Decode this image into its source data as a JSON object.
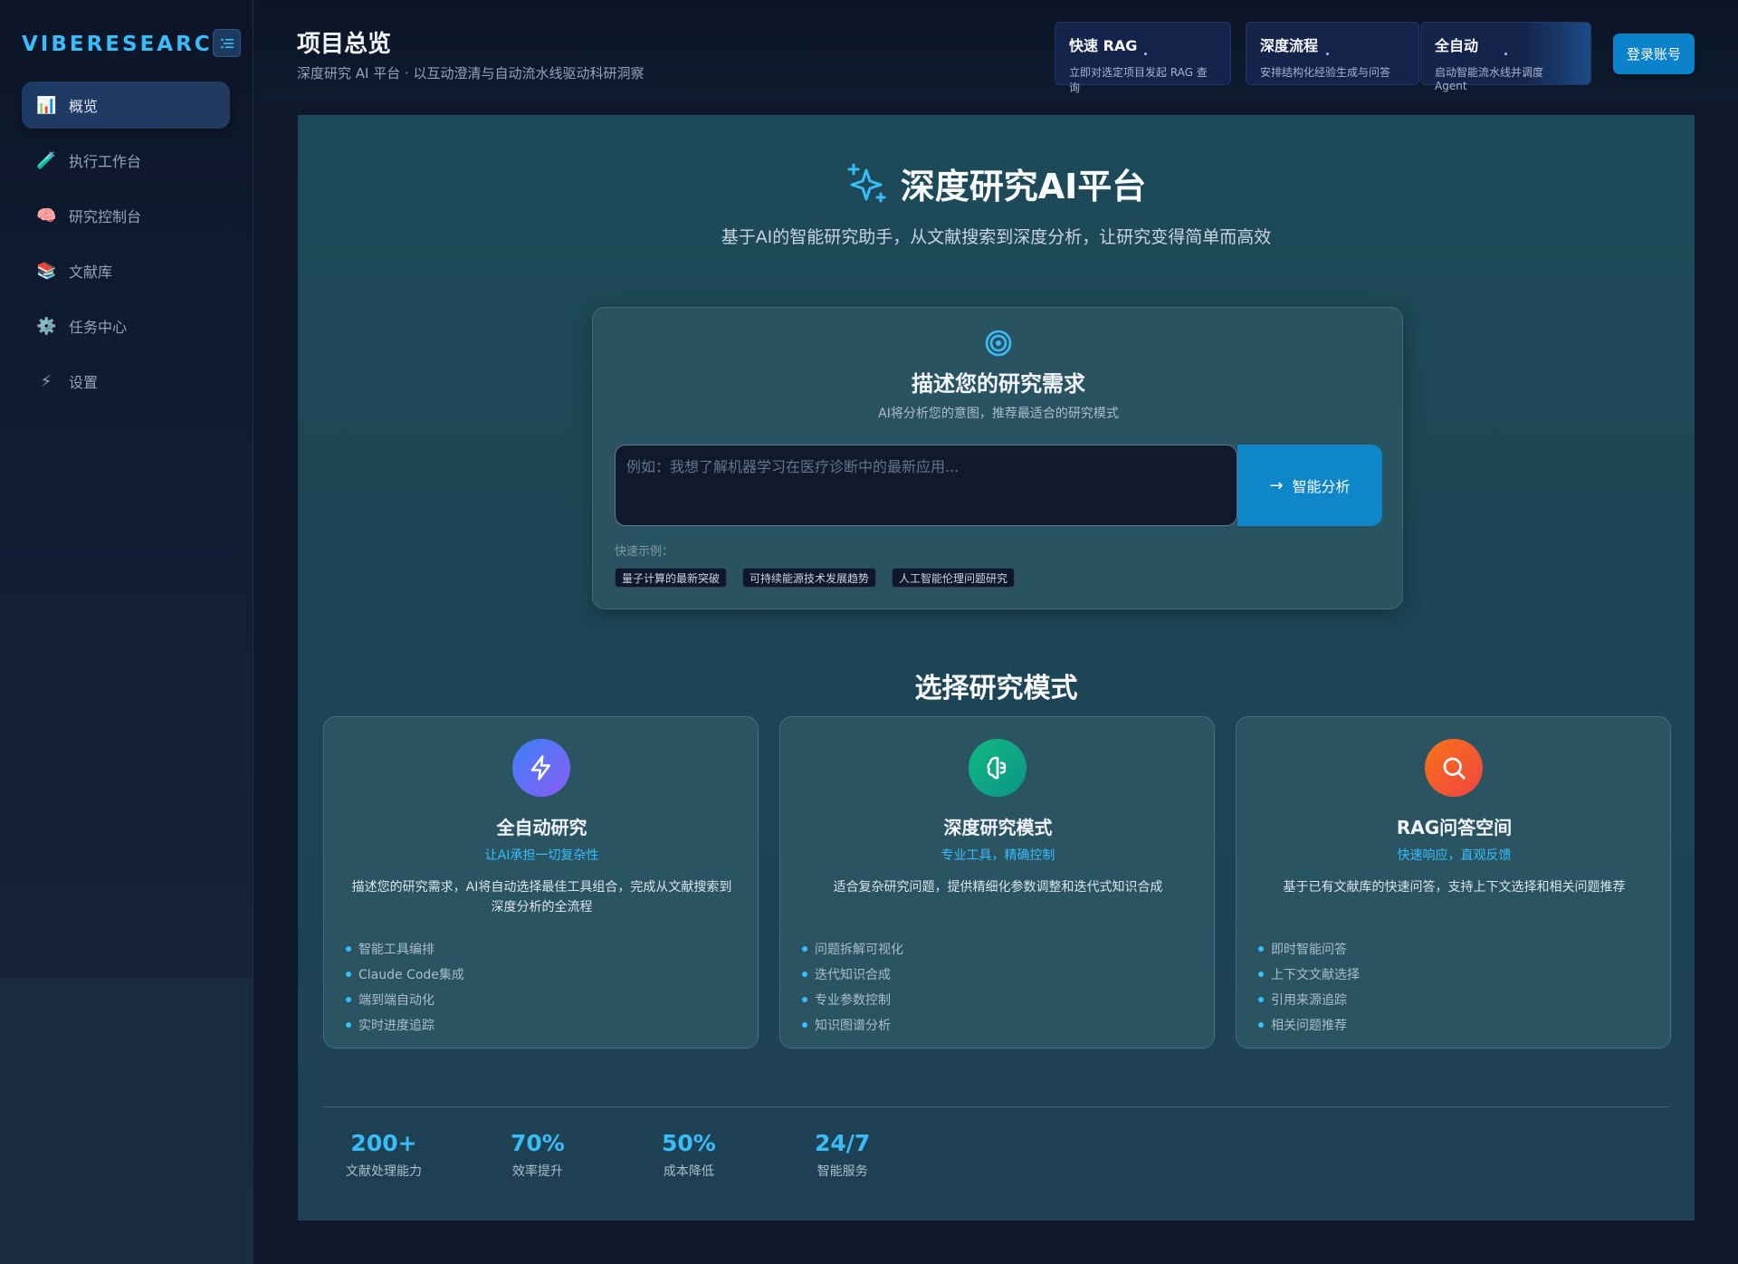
{
  "sidebar": {
    "brand": "VIBERESEARCH",
    "items": [
      {
        "label": "概览",
        "icon": "bar-chart-icon",
        "glyph": "📊",
        "active": true
      },
      {
        "label": "执行工作台",
        "icon": "test-tube-icon",
        "glyph": "🧪",
        "active": false
      },
      {
        "label": "研究控制台",
        "icon": "brain-icon",
        "glyph": "🧠",
        "active": false
      },
      {
        "label": "文献库",
        "icon": "books-icon",
        "glyph": "📚",
        "active": false
      },
      {
        "label": "任务中心",
        "icon": "gear-icon",
        "glyph": "⚙️",
        "active": false
      },
      {
        "label": "设置",
        "icon": "lightning-icon",
        "glyph": "⚡",
        "active": false
      }
    ]
  },
  "header": {
    "title": "项目总览",
    "subtitle": "深度研究 AI 平台 · 以互动澄清与自动流水线驱动科研洞察",
    "modes": [
      {
        "title": "快速 RAG",
        "desc": "立即对选定项目发起 RAG 查询"
      },
      {
        "title": "深度流程",
        "desc": "安排结构化经验生成与问答"
      },
      {
        "title": "全自动",
        "desc": "启动智能流水线并调度 Agent"
      }
    ],
    "login": "登录账号"
  },
  "hero": {
    "title": "深度研究AI平台",
    "subtitle": "基于AI的智能研究助手，从文献搜索到深度分析，让研究变得简单而高效"
  },
  "query": {
    "title": "描述您的研究需求",
    "subtitle": "AI将分析您的意图，推荐最适合的研究模式",
    "placeholder": "例如：我想了解机器学习在医疗诊断中的最新应用...",
    "button": "智能分析",
    "quick_label": "快速示例：",
    "examples": [
      "量子计算的最新突破",
      "可持续能源技术发展趋势",
      "人工智能伦理问题研究"
    ]
  },
  "modes_section": {
    "title": "选择研究模式",
    "tiles": [
      {
        "title": "全自动研究",
        "tag": "让AI承担一切复杂性",
        "desc": "描述您的研究需求，AI将自动选择最佳工具组合，完成从文献搜索到深度分析的全流程",
        "features": [
          "智能工具编排",
          "Claude Code集成",
          "端到端自动化",
          "实时进度追踪"
        ],
        "icon": "lightning-icon"
      },
      {
        "title": "深度研究模式",
        "tag": "专业工具，精确控制",
        "desc": "适合复杂研究问题，提供精细化参数调整和迭代式知识合成",
        "features": [
          "问题拆解可视化",
          "迭代知识合成",
          "专业参数控制",
          "知识图谱分析"
        ],
        "icon": "brain-icon"
      },
      {
        "title": "RAG问答空间",
        "tag": "快速响应，直观反馈",
        "desc": "基于已有文献库的快速问答，支持上下文选择和相关问题推荐",
        "features": [
          "即时智能问答",
          "上下文文献选择",
          "引用来源追踪",
          "相关问题推荐"
        ],
        "icon": "search-icon"
      }
    ]
  },
  "stats": [
    {
      "value": "200+",
      "label": "文献处理能力"
    },
    {
      "value": "70%",
      "label": "效率提升"
    },
    {
      "value": "50%",
      "label": "成本降低"
    },
    {
      "value": "24/7",
      "label": "智能服务"
    }
  ],
  "colors": {
    "accent": "#38bdf8",
    "primary_button": "#0f86c8",
    "tile_auto": "#6d5cf0",
    "tile_deep": "#10b981",
    "tile_rag": "#f97316"
  }
}
